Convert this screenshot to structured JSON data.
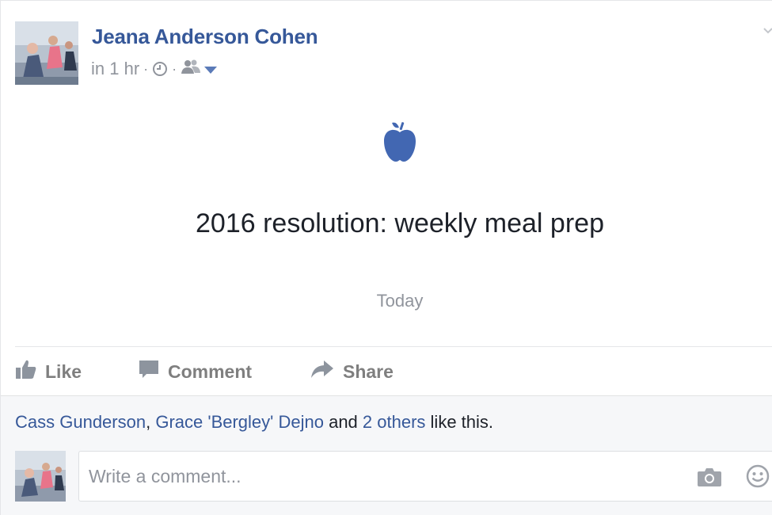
{
  "post": {
    "author": "Jeana Anderson Cohen",
    "time": "in 1 hr",
    "separator": "·",
    "icons": [
      "clock-icon",
      "friends-audience-icon",
      "caret-down-icon",
      "apple-icon"
    ],
    "life_event": {
      "title": "2016 resolution: weekly meal prep",
      "date": "Today"
    },
    "accent_color": "#365899",
    "apple_color": "#4267b2"
  },
  "actions": {
    "like": "Like",
    "comment": "Comment",
    "share": "Share"
  },
  "likes": {
    "person1": "Cass Gunderson",
    "comma": ",",
    "person2": "Grace 'Bergley' Dejno",
    "and": "and",
    "others": "2 others",
    "suffix": "like this."
  },
  "comment_box": {
    "placeholder": "Write a comment..."
  }
}
